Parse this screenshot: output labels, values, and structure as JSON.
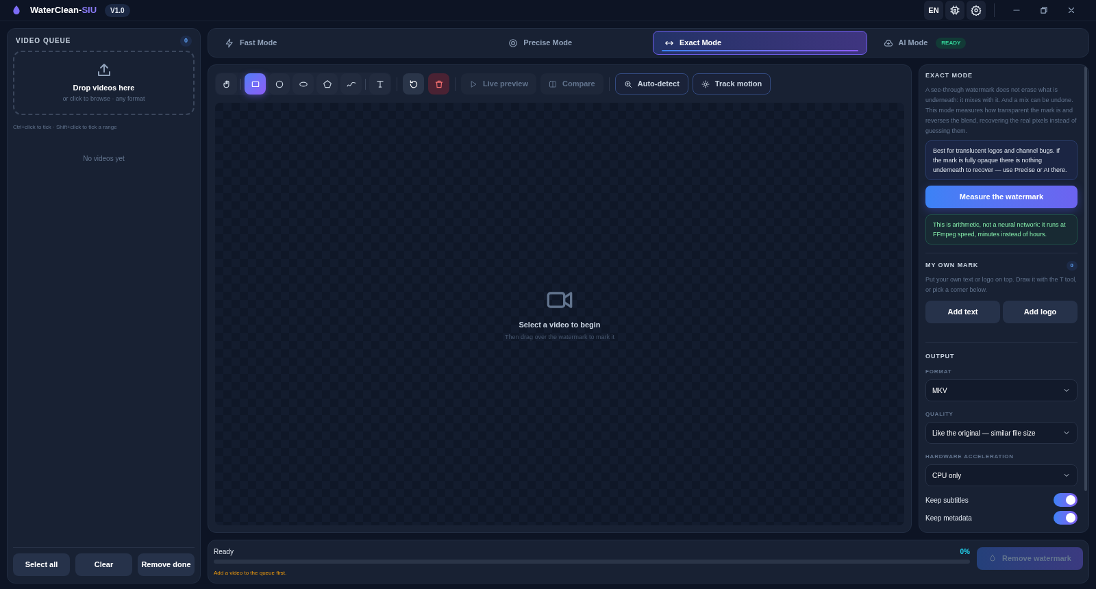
{
  "app": {
    "name": "WaterClean-",
    "name_accent": "SIU",
    "version": "V1.0",
    "language": "EN"
  },
  "queue": {
    "title": "VIDEO QUEUE",
    "count": "0",
    "drop_title": "Drop videos here",
    "drop_hint": "or click to browse · any format",
    "tip": "Ctrl+click to tick · Shift+click to tick a range",
    "empty": "No videos yet",
    "buttons": [
      "Select all",
      "Clear",
      "Remove done"
    ]
  },
  "modes": [
    {
      "label": "Fast Mode",
      "selected": false
    },
    {
      "label": "Precise Mode",
      "selected": false
    },
    {
      "label": "Exact Mode",
      "selected": true
    },
    {
      "label": "AI Mode",
      "selected": false,
      "badge": "READY"
    }
  ],
  "toolbar": [
    {
      "kind": "tool",
      "selected": false
    },
    {
      "kind": "tool",
      "selected": true
    },
    {
      "kind": "tool",
      "selected": false
    },
    {
      "kind": "tool",
      "selected": false
    },
    {
      "kind": "tool",
      "selected": false
    },
    {
      "kind": "tool",
      "selected": false
    },
    {
      "kind": "tool",
      "selected": false
    },
    {
      "kind": "action"
    },
    {
      "kind": "danger"
    },
    {
      "kind": "action",
      "label": "Live preview",
      "disabled": true
    },
    {
      "kind": "action",
      "label": "Compare",
      "disabled": true
    },
    {
      "kind": "outline",
      "label": "Auto-detect",
      "disabled": false
    },
    {
      "kind": "outline",
      "label": "Track motion",
      "disabled": false
    }
  ],
  "canvas": {
    "title": "Select a video to begin",
    "hint": "Then drag over the watermark to mark it"
  },
  "exact": {
    "title": "EXACT MODE",
    "text": "A see-through watermark does not erase what is underneath: it mixes with it. And a mix can be undone. This mode measures how transparent the mark is and reverses the blend, recovering the real pixels instead of guessing them.",
    "info": "Best for translucent logos and channel bugs. If the mark is fully opaque there is nothing underneath to recover — use Precise or AI there.",
    "button": "Measure the watermark",
    "note": "This is arithmetic, not a neural network: it runs at FFmpeg speed, minutes instead of hours."
  },
  "own_mark": {
    "title": "MY OWN MARK",
    "count": "0",
    "text": "Put your own text or logo on top. Draw it with the T tool, or pick a corner below.",
    "buttons": [
      "Add text",
      "Add logo"
    ]
  },
  "output": {
    "title": "OUTPUT",
    "selects": [
      {
        "label": "FORMAT",
        "value": "MKV"
      },
      {
        "label": "QUALITY",
        "value": "Like the original — similar file size"
      },
      {
        "label": "HARDWARE ACCELERATION",
        "value": "CPU only"
      }
    ],
    "toggles": [
      {
        "label": "Keep subtitles",
        "on": true
      },
      {
        "label": "Keep metadata",
        "on": true
      }
    ]
  },
  "status": {
    "label": "Ready",
    "percent": "0%",
    "level": 0,
    "message": "Add a video to the queue first.",
    "button": "Remove watermark",
    "button_disabled": true
  }
}
